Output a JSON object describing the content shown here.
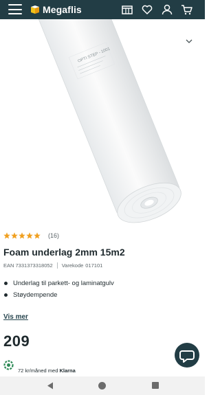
{
  "header": {
    "brand": "Megaflis",
    "icons": [
      "menu-icon",
      "store-icon",
      "heart-icon",
      "user-icon",
      "cart-icon"
    ]
  },
  "colors": {
    "header_bg": "#223d45",
    "star": "#f0a020",
    "chat_bg": "#223d45",
    "klarna_badge": "#2e8b57"
  },
  "product": {
    "rating_count": "(16)",
    "stars_filled": 5,
    "title": "Foam underlag 2mm 15m2",
    "ean": "EAN 7331373318052",
    "item_code_label": "Varekode",
    "item_code": "017101",
    "bullets": [
      "Underlag til parkett- og laminatgulv",
      "Støydempende"
    ],
    "more_link": "Vis mer",
    "price": "209",
    "klarna_prefix": "72 kr/måned med",
    "klarna_brand": "Klarna"
  },
  "image": {
    "roll_label": "OPTI STEP - 1001"
  }
}
